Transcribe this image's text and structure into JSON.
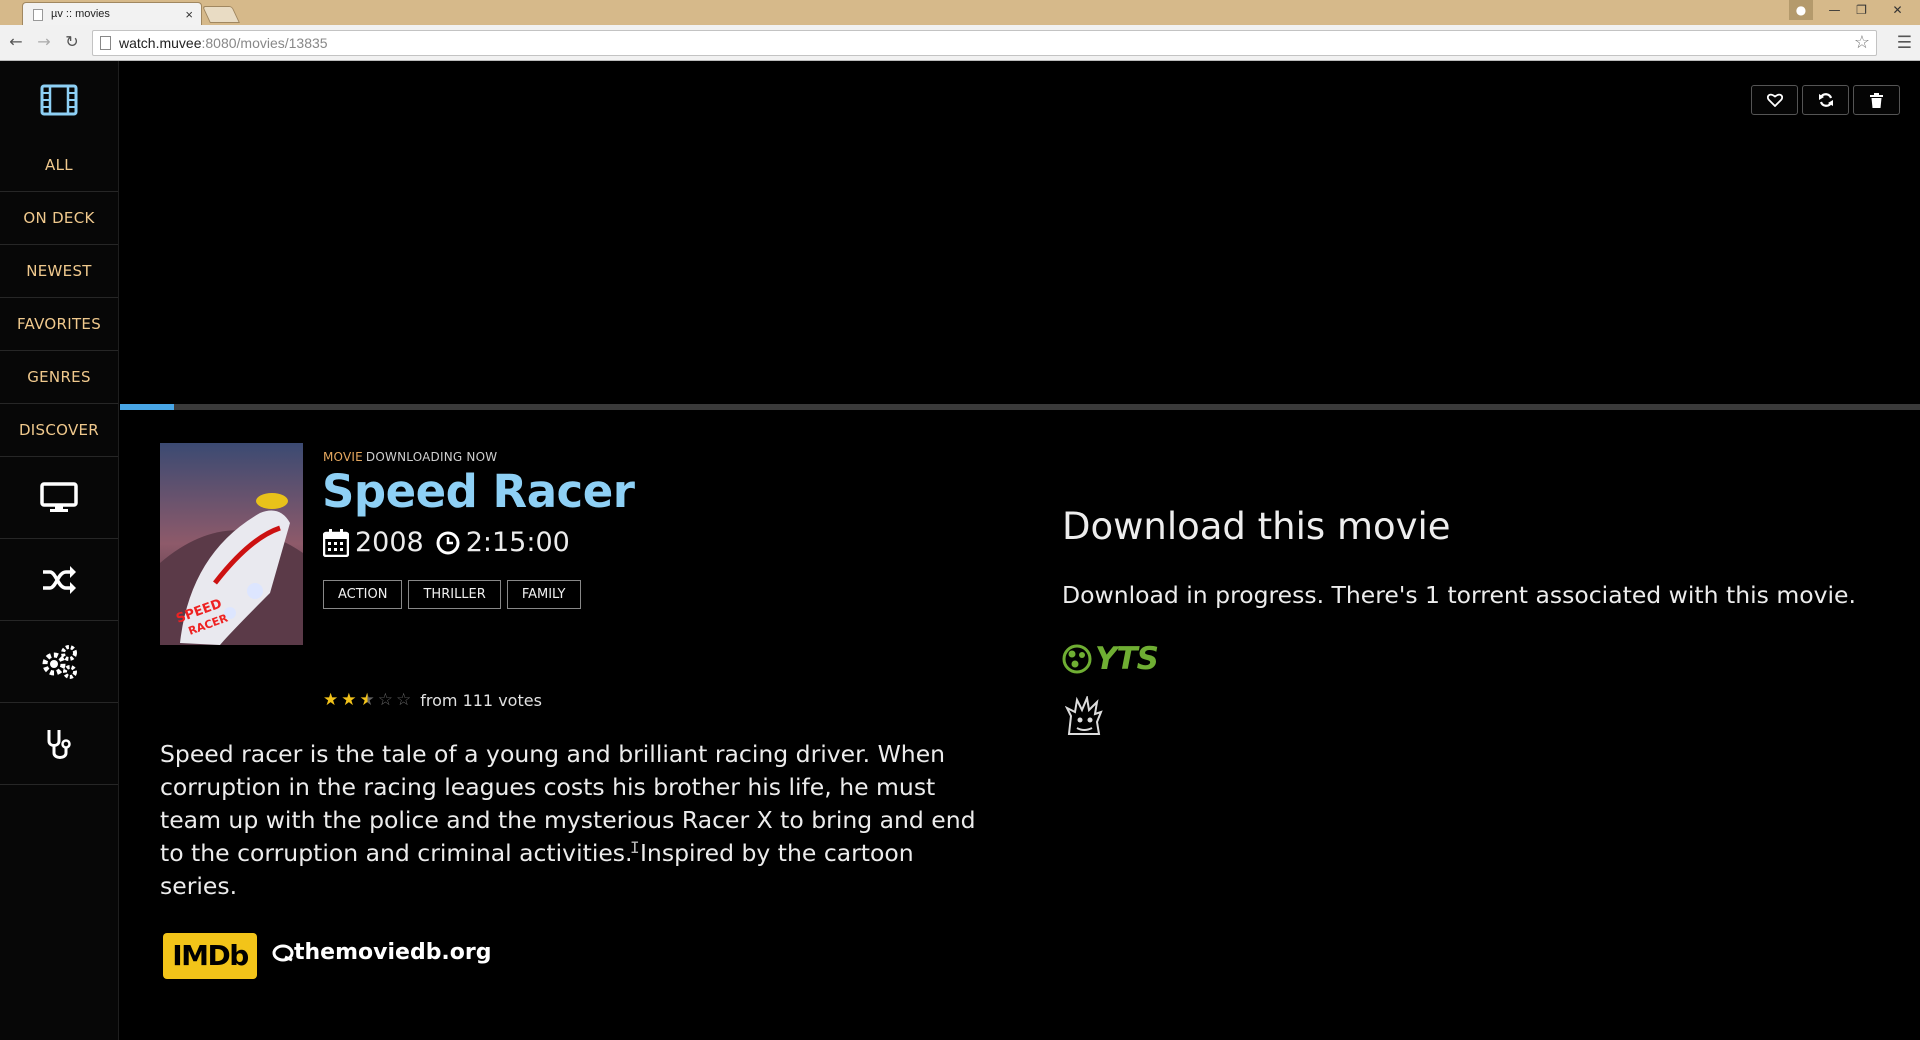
{
  "browser": {
    "tab_title": "µv :: movies",
    "tab_close": "×",
    "url_host": "watch.muvee",
    "url_rest": ":8080/movies/13835"
  },
  "sidebar": {
    "nav_items": [
      "ALL",
      "ON DECK",
      "NEWEST",
      "FAVORITES",
      "GENRES",
      "DISCOVER"
    ],
    "icon_items": [
      "monitor-icon",
      "shuffle-icon",
      "cogs-icon",
      "stethoscope-icon"
    ]
  },
  "actions": [
    "heart-icon",
    "refresh-icon",
    "trash-icon"
  ],
  "download_progress": 0.03,
  "movie": {
    "type_label": "MOVIE",
    "status_label": "DOWNLOADING NOW",
    "title": "Speed Racer",
    "year": "2008",
    "runtime": "2:15:00",
    "genres": [
      "ACTION",
      "THRILLER",
      "FAMILY"
    ],
    "rating_stars": 2.5,
    "rating_max": 5,
    "votes_text": "from 111 votes",
    "overview": "Speed racer is the tale of a young and brilliant racing driver. When corruption in the racing leagues costs his brother his life, he must team up with the police and the mysterious Racer X to bring and end to the corruption and criminal activities. Inspired by the cartoon series."
  },
  "links": {
    "imdb": "IMDb",
    "tmdb": "themoviedb.org"
  },
  "download": {
    "heading": "Download this movie",
    "status": "Download in progress. There's 1 torrent associated with this movie.",
    "sources": [
      "YTS",
      "kickass-logo"
    ]
  },
  "colors": {
    "accent": "#8ed0f5",
    "nav_text": "#f0c98d",
    "progress": "#48a6e6",
    "star": "#f2c21a",
    "imdb": "#f2c419",
    "yts": "#6fae33"
  }
}
